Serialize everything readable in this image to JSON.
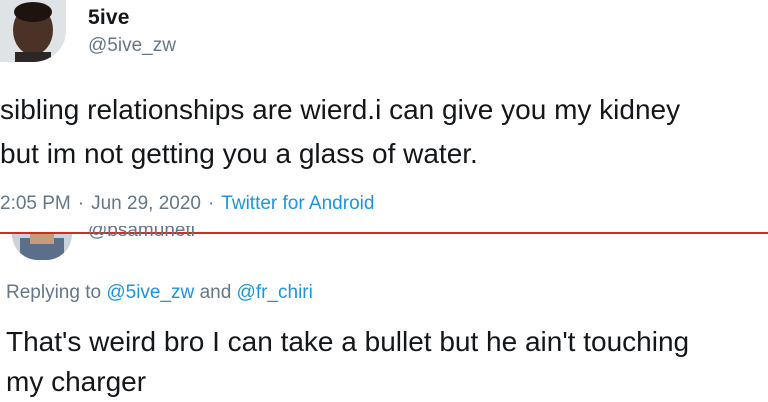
{
  "tweet": {
    "display_name": "5ive",
    "handle": "@5ive_zw",
    "text": "sibling relationships are wierd.i can give you my kidney\nbut im not getting you a glass of water.",
    "time": "2:05 PM",
    "separator": "·",
    "date": "Jun 29, 2020",
    "source": "Twitter for Android"
  },
  "reply": {
    "handle": "@bsamuneti",
    "replying_to_label": "Replying to",
    "mentions": [
      "@5ive_zw",
      "@fr_chiri"
    ],
    "and_word": "and",
    "text": "That's weird bro I can take a bullet but he ain't touching\nmy charger"
  },
  "colors": {
    "primary_text": "#14171a",
    "secondary_text": "#657786",
    "link": "#1b95e0",
    "crop_line": "#d12b25"
  }
}
